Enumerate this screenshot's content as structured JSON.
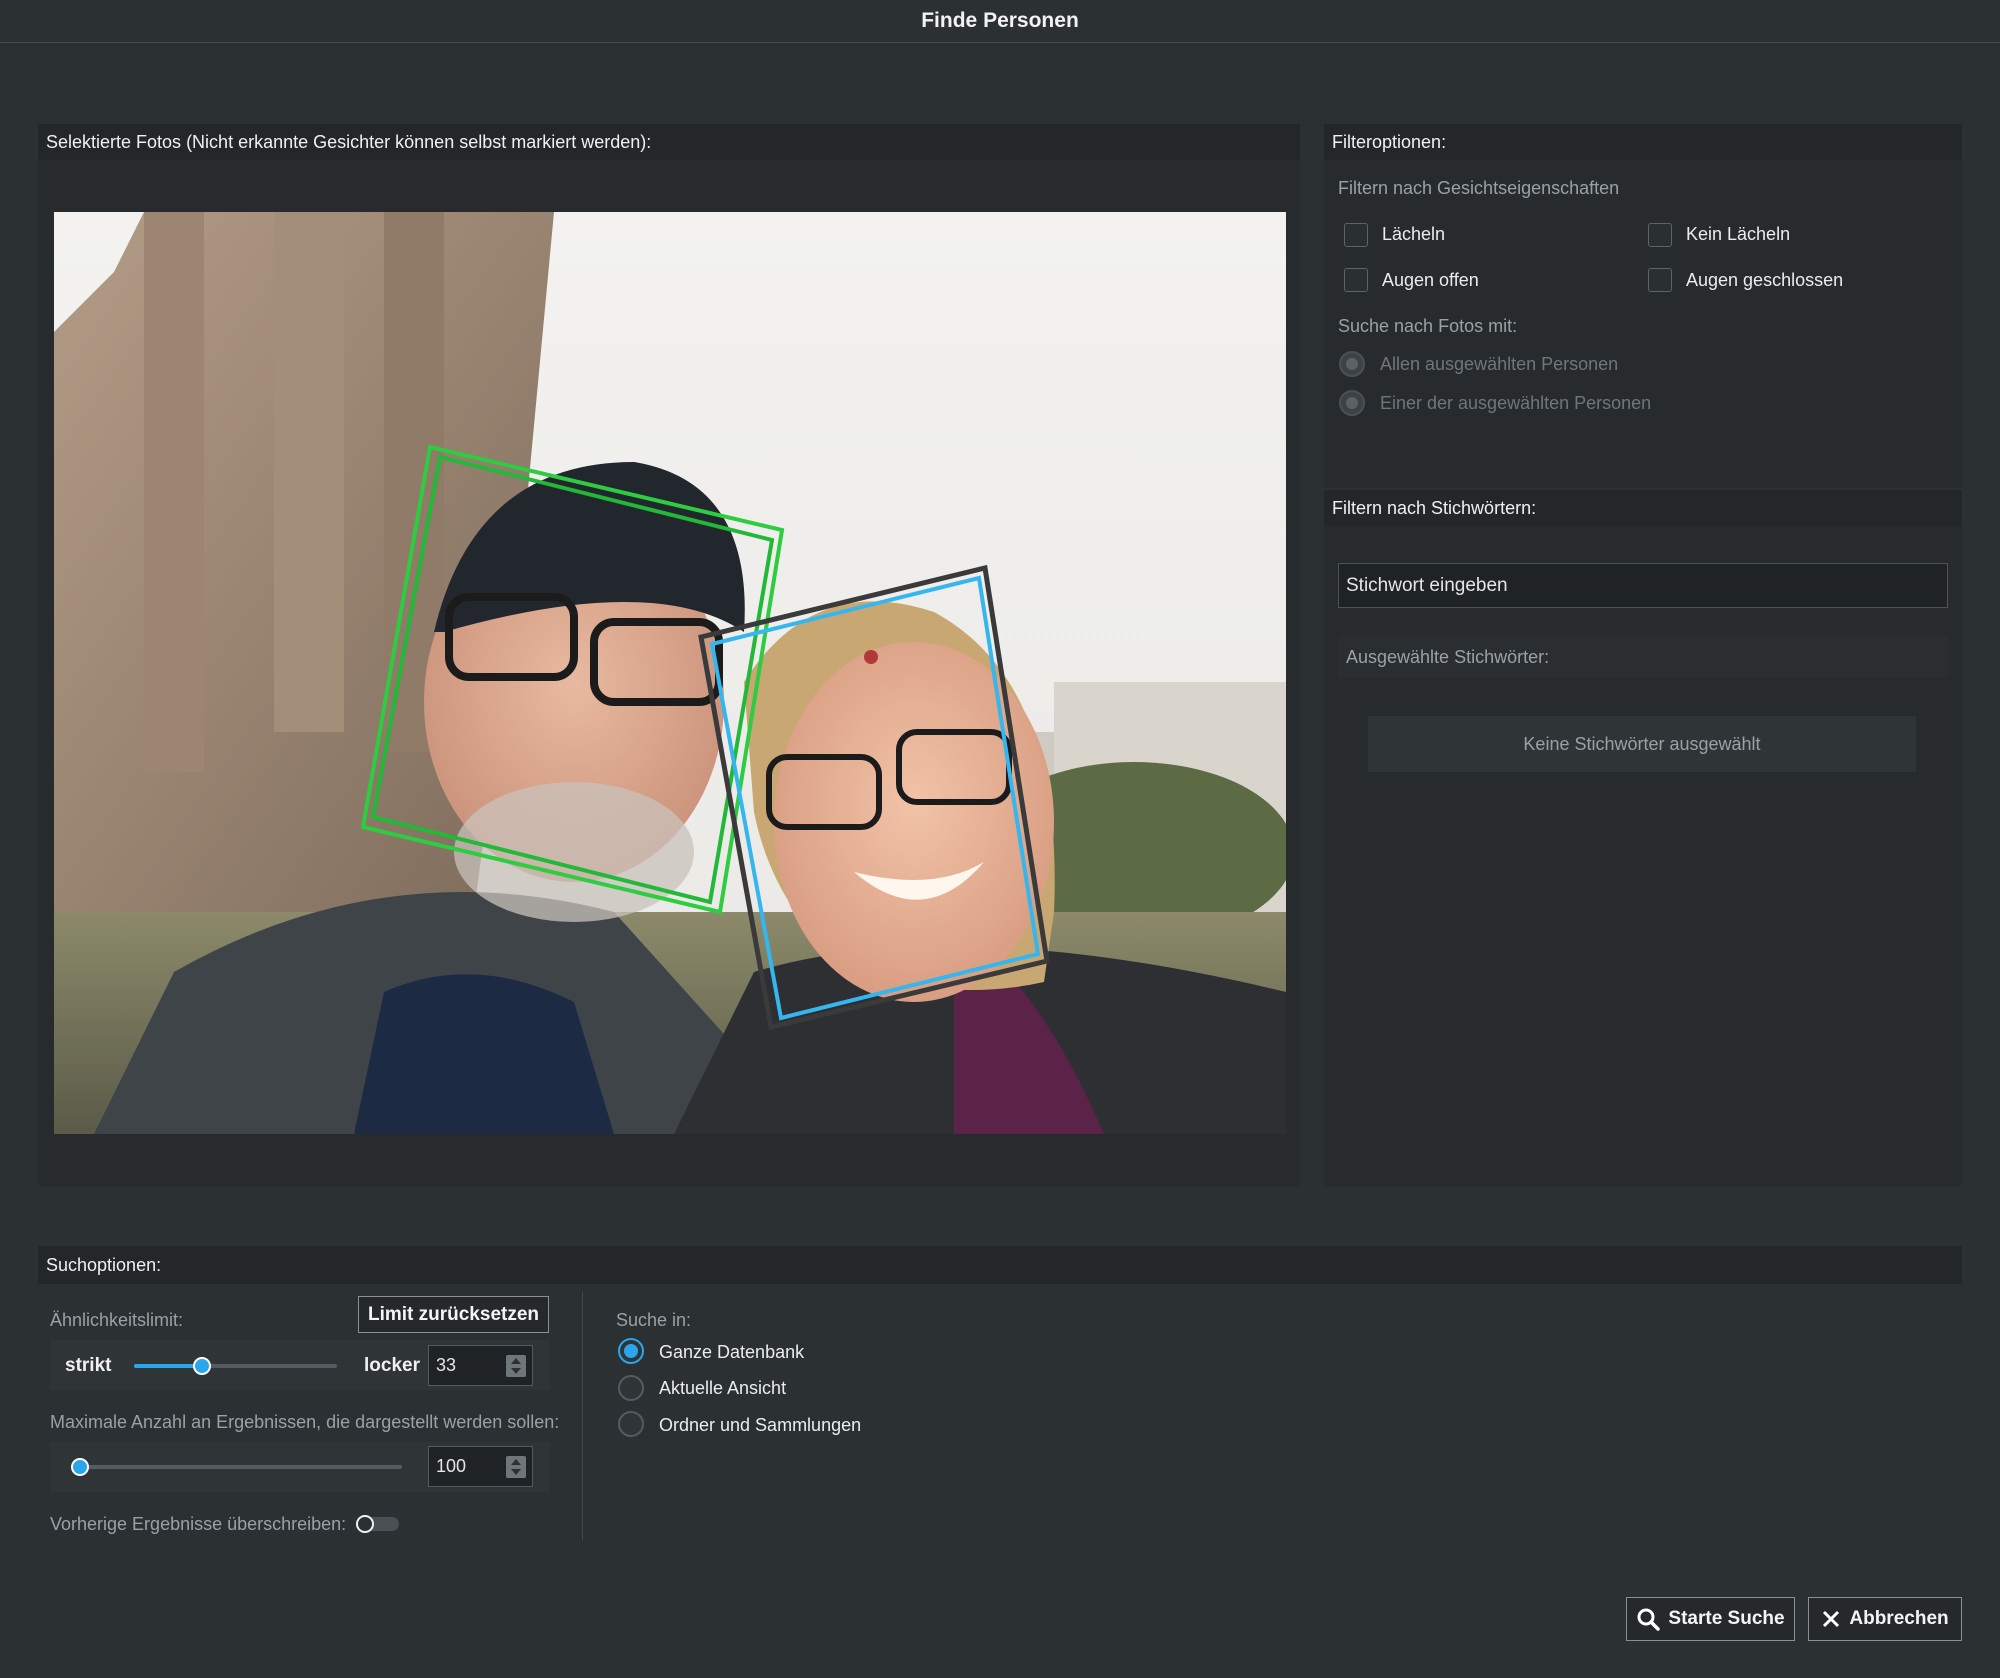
{
  "window": {
    "title": "Finde Personen"
  },
  "photo_panel": {
    "header": "Selektierte Fotos (Nicht erkannte Gesichter können selbst markiert werden):"
  },
  "filter_panel": {
    "header": "Filteroptionen:",
    "face_props_label": "Filtern nach Gesichtseigenschaften",
    "checkboxes": {
      "smile": "Lächeln",
      "no_smile": "Kein Lächeln",
      "eyes_open": "Augen offen",
      "eyes_closed": "Augen geschlossen"
    },
    "search_with_label": "Suche nach Fotos mit:",
    "radio_all": "Allen ausgewählten Personen",
    "radio_one": "Einer der ausgewählten Personen"
  },
  "keyword_panel": {
    "header": "Filtern nach Stichwörtern:",
    "input_placeholder": "Stichwort eingeben",
    "selected_label": "Ausgewählte Stichwörter:",
    "empty_text": "Keine Stichwörter ausgewählt"
  },
  "search_options": {
    "header": "Suchoptionen:",
    "similarity_label": "Ähnlichkeitslimit:",
    "reset_button": "Limit zurücksetzen",
    "strict_label": "strikt",
    "loose_label": "locker",
    "similarity_value": "33",
    "max_results_label": "Maximale Anzahl an Ergebnissen, die dargestellt werden sollen:",
    "max_results_value": "100",
    "overwrite_label": "Vorherige Ergebnisse überschreiben:",
    "search_in_label": "Suche in:",
    "search_in_options": [
      "Ganze Datenbank",
      "Aktuelle Ansicht",
      "Ordner und Sammlungen"
    ],
    "search_in_selected": "Ganze Datenbank"
  },
  "footer": {
    "start_button": "Starte Suche",
    "cancel_button": "Abbrechen"
  },
  "colors": {
    "accent": "#2aa6ec",
    "face_box_green": "#2ecc40",
    "face_box_blue": "#35b6ee",
    "face_box_dark": "#3a3a3a"
  },
  "icons": {
    "start": "search-icon",
    "cancel": "close-icon"
  }
}
